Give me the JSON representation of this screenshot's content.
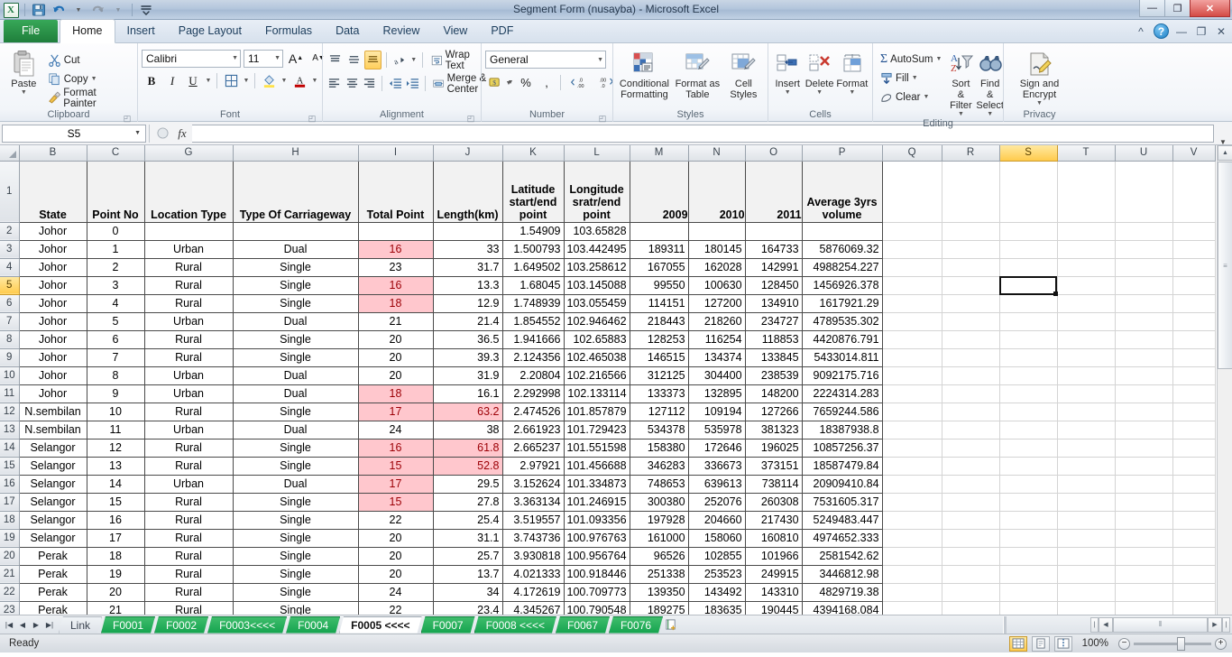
{
  "window": {
    "title": "Segment Form (nusayba)  -  Microsoft Excel",
    "minimize": "—",
    "restore": "❐",
    "close": "✕",
    "ribbon_collapse_icon": "chevron-up-icon",
    "help_icon": "?"
  },
  "qat": {
    "save_icon": "save-icon",
    "undo_icon": "undo-icon",
    "redo_icon": "redo-icon",
    "customize_icon": "customize-icon"
  },
  "tabs": [
    {
      "label": "File",
      "active": false,
      "file": true
    },
    {
      "label": "Home",
      "active": true
    },
    {
      "label": "Insert",
      "active": false
    },
    {
      "label": "Page Layout",
      "active": false
    },
    {
      "label": "Formulas",
      "active": false
    },
    {
      "label": "Data",
      "active": false
    },
    {
      "label": "Review",
      "active": false
    },
    {
      "label": "View",
      "active": false
    },
    {
      "label": "PDF",
      "active": false
    }
  ],
  "ribbon": {
    "clipboard": {
      "group_label": "Clipboard",
      "paste": "Paste",
      "cut": "Cut",
      "copy": "Copy",
      "format_painter": "Format Painter"
    },
    "font": {
      "group_label": "Font",
      "font_name": "Calibri",
      "font_size": "11",
      "grow": "A",
      "shrink": "A",
      "bold": "B",
      "italic": "I",
      "underline": "U",
      "borders": "borders-icon",
      "fill": "fill-color-icon",
      "fontcolor": "font-color-icon"
    },
    "alignment": {
      "group_label": "Alignment",
      "wrap_text": "Wrap Text",
      "merge_center": "Merge & Center",
      "orientation": "orientation-icon",
      "decrease_indent": "decrease-indent-icon",
      "increase_indent": "increase-indent-icon"
    },
    "number": {
      "group_label": "Number",
      "format": "General",
      "accounting": "accounting-format-icon",
      "percent": "%",
      "comma": ",",
      "increase_decimal": ".00",
      "decrease_decimal": ".00"
    },
    "styles": {
      "group_label": "Styles",
      "conditional_formatting": "Conditional Formatting",
      "format_as_table": "Format as Table",
      "cell_styles": "Cell Styles"
    },
    "cells": {
      "group_label": "Cells",
      "insert": "Insert",
      "delete": "Delete",
      "format": "Format"
    },
    "editing": {
      "group_label": "Editing",
      "autosum": "AutoSum",
      "fill": "Fill",
      "clear": "Clear",
      "sort_filter": "Sort & Filter",
      "find_select": "Find & Select"
    },
    "privacy": {
      "group_label": "Privacy",
      "sign_encrypt": "Sign and Encrypt"
    }
  },
  "formula_bar": {
    "name_box": "S5",
    "formula": "",
    "fx": "fx",
    "cancel_icon": "cancel-icon",
    "enter_icon": "enter-icon",
    "expand_icon": "expand-formula-bar-icon"
  },
  "grid": {
    "columns": [
      "B",
      "C",
      "G",
      "H",
      "I",
      "J",
      "K",
      "L",
      "M",
      "N",
      "O",
      "P",
      "Q",
      "R",
      "S",
      "T",
      "U",
      "V"
    ],
    "selected_column": "S",
    "selected_row": "5",
    "active_cell": "S5",
    "row_numbers": [
      "1",
      "2",
      "3",
      "4",
      "5",
      "6",
      "7",
      "8",
      "9",
      "10",
      "11",
      "12",
      "13",
      "14",
      "15",
      "16",
      "17",
      "18",
      "19",
      "20",
      "21",
      "22",
      "23"
    ],
    "headers": [
      "State",
      "Point No",
      "Location Type",
      "Type Of Carriageway",
      "Total Point",
      "Length(km)",
      "Latitude start/end point",
      "Longitude sratr/end point",
      "",
      "",
      "",
      "Average 3yrs volume"
    ],
    "header_years": {
      "M": "2009",
      "N": "2010",
      "O": "2011"
    },
    "rows": [
      {
        "row": "2",
        "state": "Johor",
        "point_no": "0",
        "location_type": "",
        "carriageway": "",
        "total_point": "",
        "total_pink": false,
        "length": "",
        "length_pink": false,
        "lat": "1.54909",
        "lon": "103.65828",
        "y2009": "",
        "y2010": "",
        "y2011": "",
        "avg": ""
      },
      {
        "row": "3",
        "state": "Johor",
        "point_no": "1",
        "location_type": "Urban",
        "carriageway": "Dual",
        "total_point": "16",
        "total_pink": true,
        "length": "33",
        "length_pink": false,
        "lat": "1.500793",
        "lon": "103.442495",
        "y2009": "189311",
        "y2010": "180145",
        "y2011": "164733",
        "avg": "5876069.32"
      },
      {
        "row": "4",
        "state": "Johor",
        "point_no": "2",
        "location_type": "Rural",
        "carriageway": "Single",
        "total_point": "23",
        "total_pink": false,
        "length": "31.7",
        "length_pink": false,
        "lat": "1.649502",
        "lon": "103.258612",
        "y2009": "167055",
        "y2010": "162028",
        "y2011": "142991",
        "avg": "4988254.227"
      },
      {
        "row": "5",
        "state": "Johor",
        "point_no": "3",
        "location_type": "Rural",
        "carriageway": "Single",
        "total_point": "16",
        "total_pink": true,
        "length": "13.3",
        "length_pink": false,
        "lat": "1.68045",
        "lon": "103.145088",
        "y2009": "99550",
        "y2010": "100630",
        "y2011": "128450",
        "avg": "1456926.378"
      },
      {
        "row": "6",
        "state": "Johor",
        "point_no": "4",
        "location_type": "Rural",
        "carriageway": "Single",
        "total_point": "18",
        "total_pink": true,
        "length": "12.9",
        "length_pink": false,
        "lat": "1.748939",
        "lon": "103.055459",
        "y2009": "114151",
        "y2010": "127200",
        "y2011": "134910",
        "avg": "1617921.29"
      },
      {
        "row": "7",
        "state": "Johor",
        "point_no": "5",
        "location_type": "Urban",
        "carriageway": "Dual",
        "total_point": "21",
        "total_pink": false,
        "length": "21.4",
        "length_pink": false,
        "lat": "1.854552",
        "lon": "102.946462",
        "y2009": "218443",
        "y2010": "218260",
        "y2011": "234727",
        "avg": "4789535.302"
      },
      {
        "row": "8",
        "state": "Johor",
        "point_no": "6",
        "location_type": "Rural",
        "carriageway": "Single",
        "total_point": "20",
        "total_pink": false,
        "length": "36.5",
        "length_pink": false,
        "lat": "1.941666",
        "lon": "102.65883",
        "y2009": "128253",
        "y2010": "116254",
        "y2011": "118853",
        "avg": "4420876.791"
      },
      {
        "row": "9",
        "state": "Johor",
        "point_no": "7",
        "location_type": "Rural",
        "carriageway": "Single",
        "total_point": "20",
        "total_pink": false,
        "length": "39.3",
        "length_pink": false,
        "lat": "2.124356",
        "lon": "102.465038",
        "y2009": "146515",
        "y2010": "134374",
        "y2011": "133845",
        "avg": "5433014.811"
      },
      {
        "row": "10",
        "state": "Johor",
        "point_no": "8",
        "location_type": "Urban",
        "carriageway": "Dual",
        "total_point": "20",
        "total_pink": false,
        "length": "31.9",
        "length_pink": false,
        "lat": "2.20804",
        "lon": "102.216566",
        "y2009": "312125",
        "y2010": "304400",
        "y2011": "238539",
        "avg": "9092175.716"
      },
      {
        "row": "11",
        "state": "Johor",
        "point_no": "9",
        "location_type": "Urban",
        "carriageway": "Dual",
        "total_point": "18",
        "total_pink": true,
        "length": "16.1",
        "length_pink": false,
        "lat": "2.292998",
        "lon": "102.133114",
        "y2009": "133373",
        "y2010": "132895",
        "y2011": "148200",
        "avg": "2224314.283"
      },
      {
        "row": "12",
        "state": "N.sembilan",
        "point_no": "10",
        "location_type": "Rural",
        "carriageway": "Single",
        "total_point": "17",
        "total_pink": true,
        "length": "63.2",
        "length_pink": true,
        "lat": "2.474526",
        "lon": "101.857879",
        "y2009": "127112",
        "y2010": "109194",
        "y2011": "127266",
        "avg": "7659244.586"
      },
      {
        "row": "13",
        "state": "N.sembilan",
        "point_no": "11",
        "location_type": "Urban",
        "carriageway": "Dual",
        "total_point": "24",
        "total_pink": false,
        "length": "38",
        "length_pink": false,
        "lat": "2.661923",
        "lon": "101.729423",
        "y2009": "534378",
        "y2010": "535978",
        "y2011": "381323",
        "avg": "18387938.8"
      },
      {
        "row": "14",
        "state": "Selangor",
        "point_no": "12",
        "location_type": "Rural",
        "carriageway": "Single",
        "total_point": "16",
        "total_pink": true,
        "length": "61.8",
        "length_pink": true,
        "lat": "2.665237",
        "lon": "101.551598",
        "y2009": "158380",
        "y2010": "172646",
        "y2011": "196025",
        "avg": "10857256.37"
      },
      {
        "row": "15",
        "state": "Selangor",
        "point_no": "13",
        "location_type": "Rural",
        "carriageway": "Single",
        "total_point": "15",
        "total_pink": true,
        "length": "52.8",
        "length_pink": true,
        "lat": "2.97921",
        "lon": "101.456688",
        "y2009": "346283",
        "y2010": "336673",
        "y2011": "373151",
        "avg": "18587479.84"
      },
      {
        "row": "16",
        "state": "Selangor",
        "point_no": "14",
        "location_type": "Urban",
        "carriageway": "Dual",
        "total_point": "17",
        "total_pink": true,
        "length": "29.5",
        "length_pink": false,
        "lat": "3.152624",
        "lon": "101.334873",
        "y2009": "748653",
        "y2010": "639613",
        "y2011": "738114",
        "avg": "20909410.84"
      },
      {
        "row": "17",
        "state": "Selangor",
        "point_no": "15",
        "location_type": "Rural",
        "carriageway": "Single",
        "total_point": "15",
        "total_pink": true,
        "length": "27.8",
        "length_pink": false,
        "lat": "3.363134",
        "lon": "101.246915",
        "y2009": "300380",
        "y2010": "252076",
        "y2011": "260308",
        "avg": "7531605.317"
      },
      {
        "row": "18",
        "state": "Selangor",
        "point_no": "16",
        "location_type": "Rural",
        "carriageway": "Single",
        "total_point": "22",
        "total_pink": false,
        "length": "25.4",
        "length_pink": false,
        "lat": "3.519557",
        "lon": "101.093356",
        "y2009": "197928",
        "y2010": "204660",
        "y2011": "217430",
        "avg": "5249483.447"
      },
      {
        "row": "19",
        "state": "Selangor",
        "point_no": "17",
        "location_type": "Rural",
        "carriageway": "Single",
        "total_point": "20",
        "total_pink": false,
        "length": "31.1",
        "length_pink": false,
        "lat": "3.743736",
        "lon": "100.976763",
        "y2009": "161000",
        "y2010": "158060",
        "y2011": "160810",
        "avg": "4974652.333"
      },
      {
        "row": "20",
        "state": "Perak",
        "point_no": "18",
        "location_type": "Rural",
        "carriageway": "Single",
        "total_point": "20",
        "total_pink": false,
        "length": "25.7",
        "length_pink": false,
        "lat": "3.930818",
        "lon": "100.956764",
        "y2009": "96526",
        "y2010": "102855",
        "y2011": "101966",
        "avg": "2581542.62"
      },
      {
        "row": "21",
        "state": "Perak",
        "point_no": "19",
        "location_type": "Rural",
        "carriageway": "Single",
        "total_point": "20",
        "total_pink": false,
        "length": "13.7",
        "length_pink": false,
        "lat": "4.021333",
        "lon": "100.918446",
        "y2009": "251338",
        "y2010": "253523",
        "y2011": "249915",
        "avg": "3446812.98"
      },
      {
        "row": "22",
        "state": "Perak",
        "point_no": "20",
        "location_type": "Rural",
        "carriageway": "Single",
        "total_point": "24",
        "total_pink": false,
        "length": "34",
        "length_pink": false,
        "lat": "4.172619",
        "lon": "100.709773",
        "y2009": "139350",
        "y2010": "143492",
        "y2011": "143310",
        "avg": "4829719.38"
      },
      {
        "row": "23",
        "state": "Perak",
        "point_no": "21",
        "location_type": "Rural",
        "carriageway": "Single",
        "total_point": "22",
        "total_pink": false,
        "length": "23.4",
        "length_pink": false,
        "lat": "4.345267",
        "lon": "100.790548",
        "y2009": "189275",
        "y2010": "183635",
        "y2011": "190445",
        "avg": "4394168.084"
      }
    ]
  },
  "sheet_tabs": [
    {
      "label": "Link",
      "active": false,
      "link": true
    },
    {
      "label": "F0001",
      "active": false,
      "link": false
    },
    {
      "label": "F0002",
      "active": false,
      "link": false
    },
    {
      "label": "F0003<<<<",
      "active": false,
      "link": false
    },
    {
      "label": "F0004",
      "active": false,
      "link": false
    },
    {
      "label": "F0005 <<<<",
      "active": true,
      "link": false
    },
    {
      "label": "F0007",
      "active": false,
      "link": false
    },
    {
      "label": "F0008 <<<<",
      "active": false,
      "link": false
    },
    {
      "label": "F0067",
      "active": false,
      "link": false
    },
    {
      "label": "F0076",
      "active": false,
      "link": false
    }
  ],
  "status": {
    "text": "Ready",
    "zoom": "100%",
    "zoom_out": "−",
    "zoom_in": "+",
    "view_normal": "normal-view-icon",
    "view_layout": "page-layout-view-icon",
    "view_break": "page-break-view-icon"
  },
  "colors": {
    "accent_green": "#1f7e3b",
    "pink_fill": "#ffc7cd",
    "pink_text": "#9c0006",
    "selection_yellow": "#ffcb4d"
  }
}
